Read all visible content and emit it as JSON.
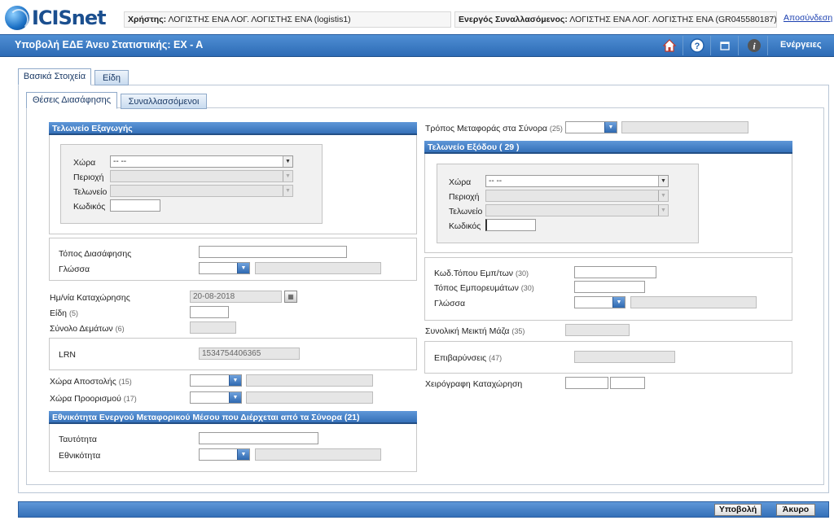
{
  "header": {
    "logo_text": "ICISnet",
    "user_label": "Χρήστης:",
    "user_value": "ΛΟΓΙΣΤΗΣ ΕΝΑ ΛΟΓ. ΛΟΓΙΣΤΗΣ ΕΝΑ (logistis1)",
    "trader_label": "Ενεργός Συναλλασόμενος:",
    "trader_value": "ΛΟΓΙΣΤΗΣ ΕΝΑ ΛΟΓ. ΛΟΓΙΣΤΗΣ ΕΝΑ (GR045580187)",
    "logout": "Αποσύνδεση"
  },
  "titlebar": {
    "title": "Υποβολή ΕΔΕ Άνευ Στατιστικής: ΕΧ - Α",
    "actions": "Ενέργειες",
    "icons": [
      "home-icon",
      "help-icon",
      "window-icon",
      "info-icon"
    ]
  },
  "tabs": {
    "main": [
      "Βασικά Στοιχεία",
      "Είδη"
    ],
    "sub": [
      "Θέσεις Διασάφησης",
      "Συναλλασσόμενοι"
    ]
  },
  "left": {
    "export_office": {
      "header": "Τελωνείο Εξαγωγής",
      "country_label": "Χώρα",
      "country_value": "-- --",
      "region_label": "Περιοχή",
      "office_label": "Τελωνείο",
      "code_label": "Κωδικός"
    },
    "declaration_place_label": "Τόπος Διασάφησης",
    "language_label": "Γλώσσα",
    "registration_date_label": "Ημ/νία Καταχώρησης",
    "registration_date_value": "20-08-2018",
    "items_label": "Είδη",
    "items_num": "(5)",
    "packages_label": "Σύνολο Δεμάτων",
    "packages_num": "(6)",
    "lrn_label": "LRN",
    "lrn_value": "1534754406365",
    "dispatch_country_label": "Χώρα Αποστολής",
    "dispatch_country_num": "(15)",
    "destination_country_label": "Χώρα Προορισμού",
    "destination_country_num": "(17)",
    "nationality_header": "Εθνικότητα Ενεργού Μεταφορικού Μέσου που Διέρχεται από τα Σύνορα (21)",
    "identity_label": "Ταυτότητα",
    "nationality_label": "Εθνικότητα"
  },
  "right": {
    "transport_mode_label": "Τρόπος Μεταφοράς στα Σύνορα",
    "transport_mode_num": "(25)",
    "exit_office": {
      "header": "Τελωνείο Εξόδου ( 29 )",
      "country_label": "Χώρα",
      "country_value": "-- --",
      "region_label": "Περιοχή",
      "office_label": "Τελωνείο",
      "code_label": "Κωδικός"
    },
    "goods_place_code_label": "Κωδ.Τόπου Εμπ/των",
    "goods_place_code_num": "(30)",
    "goods_place_label": "Τόπος Εμπορευμάτων",
    "goods_place_num": "(30)",
    "language_label": "Γλώσσα",
    "gross_mass_label": "Συνολική Μεικτή Μάζα",
    "gross_mass_num": "(35)",
    "charges_label": "Επιβαρύνσεις",
    "charges_num": "(47)",
    "manual_label": "Χειρόγραφη Καταχώρηση"
  },
  "footer": {
    "submit": "Υποβολή",
    "cancel": "Άκυρο"
  }
}
